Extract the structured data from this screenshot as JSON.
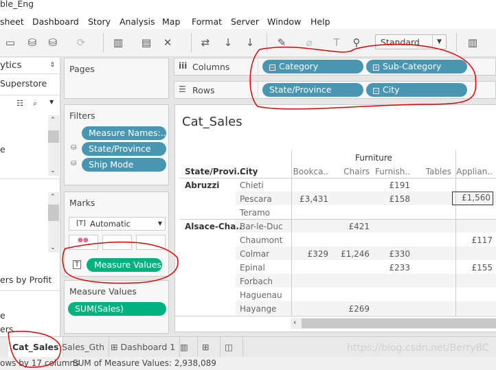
{
  "window": {
    "title": "ble_Eng"
  },
  "menu": [
    "sheet",
    "Dashboard",
    "Story",
    "Analysis",
    "Map",
    "Format",
    "Server",
    "Window",
    "Help"
  ],
  "toolbar": {
    "fit_select": "Standard"
  },
  "data_pane": {
    "tab": "ytics",
    "datasource": "Superstore",
    "items": [
      "e",
      "ers by Profit",
      "e",
      "ers"
    ]
  },
  "pages": {
    "label": "Pages"
  },
  "filters": {
    "label": "Filters",
    "items": [
      "Measure Names:..",
      "State/Province",
      "Ship Mode"
    ]
  },
  "marks": {
    "label": "Marks",
    "type": "Automatic",
    "pill": "Measure Values"
  },
  "measure_values": {
    "label": "Measure Values",
    "items": [
      "SUM(Sales)"
    ]
  },
  "shelves": {
    "columns_label": "Columns",
    "rows_label": "Rows",
    "columns": [
      "Category",
      "Sub-Category"
    ],
    "rows": [
      "State/Province",
      "City"
    ]
  },
  "view": {
    "title": "Cat_Sales",
    "category_header": "Furniture",
    "row_headers": [
      "State/Provi..",
      "City"
    ],
    "columns": [
      "Bookca..",
      "Chairs",
      "Furnish..",
      "Tables",
      "Applian.."
    ],
    "groups": [
      {
        "state": "Abruzzi",
        "rows": [
          {
            "city": "Chieti",
            "values": [
              "",
              "",
              "£191",
              "",
              ""
            ]
          },
          {
            "city": "Pescara",
            "values": [
              "£3,431",
              "",
              "£158",
              "",
              "£1,560"
            ]
          },
          {
            "city": "Teramo",
            "values": [
              "",
              "",
              "",
              "",
              ""
            ]
          }
        ]
      },
      {
        "state": "Alsace-Cha..",
        "rows": [
          {
            "city": "Bar-le-Duc",
            "values": [
              "",
              "£421",
              "",
              "",
              ""
            ]
          },
          {
            "city": "Chaumont",
            "values": [
              "",
              "",
              "",
              "",
              "£117"
            ]
          },
          {
            "city": "Colmar",
            "values": [
              "£329",
              "£1,246",
              "£330",
              "",
              ""
            ]
          },
          {
            "city": "Epinal",
            "values": [
              "",
              "",
              "£233",
              "",
              "£155"
            ]
          },
          {
            "city": "Forbach",
            "values": [
              "",
              "",
              "",
              "",
              ""
            ]
          },
          {
            "city": "Haguenau",
            "values": [
              "",
              "",
              "",
              "",
              ""
            ]
          },
          {
            "city": "Hayange",
            "values": [
              "",
              "£269",
              "",
              "",
              ""
            ]
          }
        ]
      }
    ]
  },
  "tabs": [
    "Cat_Sales",
    "Sales_Gth",
    "Dashboard 1"
  ],
  "status": {
    "rows_cols": "ows by 17 columns",
    "sum": "SUM of Measure Values: 2,938,089"
  },
  "watermark": "https://blog.csdn.net/BerryBC",
  "colors": {
    "dimension_pill": "#4996b2",
    "measure_pill": "#00b180",
    "annotation": "#e00000"
  }
}
